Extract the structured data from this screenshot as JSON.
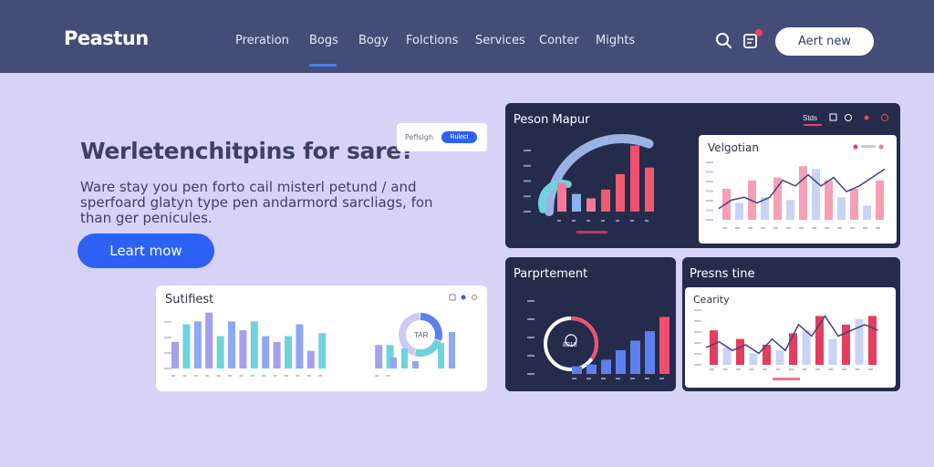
{
  "nav": {
    "logo": "Peastun",
    "items": [
      "Preration",
      "Bogs",
      "Bogy",
      "Folctions",
      "Services",
      "Conter",
      "Mights"
    ],
    "cta": "Aert new",
    "icons": [
      "search-icon",
      "notification-icon"
    ]
  },
  "hero": {
    "headline": "Werletenchitpins for sare?",
    "subtext": "Ware stay you pen forto cail misterl petund / and sperfoard glatyn type pen andarmord sarcliags, fon than ger penicules.",
    "cta": "Leart mow"
  },
  "mini_card": {
    "label": "Pefislgh",
    "pill": "Rulect"
  },
  "cards": {
    "peson_mapur": {
      "title": "Peson Mapur",
      "tab": "Stds"
    },
    "velgotian": {
      "title": "Velgotian"
    },
    "sutifiest": {
      "title": "Sutifiest",
      "donut_label": "TAR"
    },
    "parprtement": {
      "title": "Parprtement",
      "ring_label": "8018"
    },
    "presens_tine": {
      "title": "Presns tine"
    },
    "cearity": {
      "title": "Cearity"
    }
  },
  "colors": {
    "navbar": "#444d78",
    "background": "#d6d3f7",
    "primary": "#2b62f4",
    "dark_card": "#252c4b",
    "pink": "#f27a96",
    "red": "#e43d5e",
    "blue": "#5d7ff0",
    "lavender": "#a6a0ec",
    "teal": "#6fd3dd"
  },
  "chart_data": [
    {
      "type": "bar",
      "chart": "peson_mapur",
      "values": [
        13,
        8,
        6,
        10,
        17,
        30,
        20
      ],
      "ylim": [
        0,
        36
      ],
      "series_colors": [
        "#f27a96",
        "#8ab4f0",
        "#f27a96",
        "#f05a6e",
        "#f05a6e",
        "#f0506e",
        "#f05a6e"
      ]
    },
    {
      "type": "bar",
      "chart": "velgotian",
      "series": [
        {
          "values": [
            55,
            30,
            70,
            40,
            75,
            35,
            95,
            90,
            70,
            40,
            55,
            25,
            70
          ]
        }
      ],
      "line": [
        20,
        35,
        40,
        30,
        40,
        70,
        60,
        80,
        60,
        75,
        50,
        60,
        75,
        90
      ],
      "ylim": [
        0,
        110
      ]
    },
    {
      "type": "bar",
      "chart": "sutifiest",
      "values": [
        45,
        75,
        80,
        95,
        55,
        80,
        65,
        80,
        55,
        45,
        55,
        75,
        30,
        60,
        80,
        45,
        45,
        85,
        40,
        40
      ],
      "ylim": [
        0,
        110
      ],
      "donut": [
        0.3,
        0.25,
        0.45
      ]
    },
    {
      "type": "bar",
      "chart": "parprtement",
      "values": [
        8,
        10,
        15,
        25,
        35,
        45,
        60
      ],
      "ylim": [
        0,
        70
      ],
      "ring_fraction": 0.35
    },
    {
      "type": "bar",
      "chart": "cearity",
      "values": [
        60,
        30,
        45,
        20,
        35,
        25,
        55,
        60,
        85,
        45,
        70,
        80,
        85
      ],
      "line": [
        30,
        40,
        25,
        35,
        20,
        45,
        25,
        70,
        50,
        85,
        50,
        60,
        70,
        60
      ],
      "ylim": [
        0,
        100
      ]
    }
  ]
}
